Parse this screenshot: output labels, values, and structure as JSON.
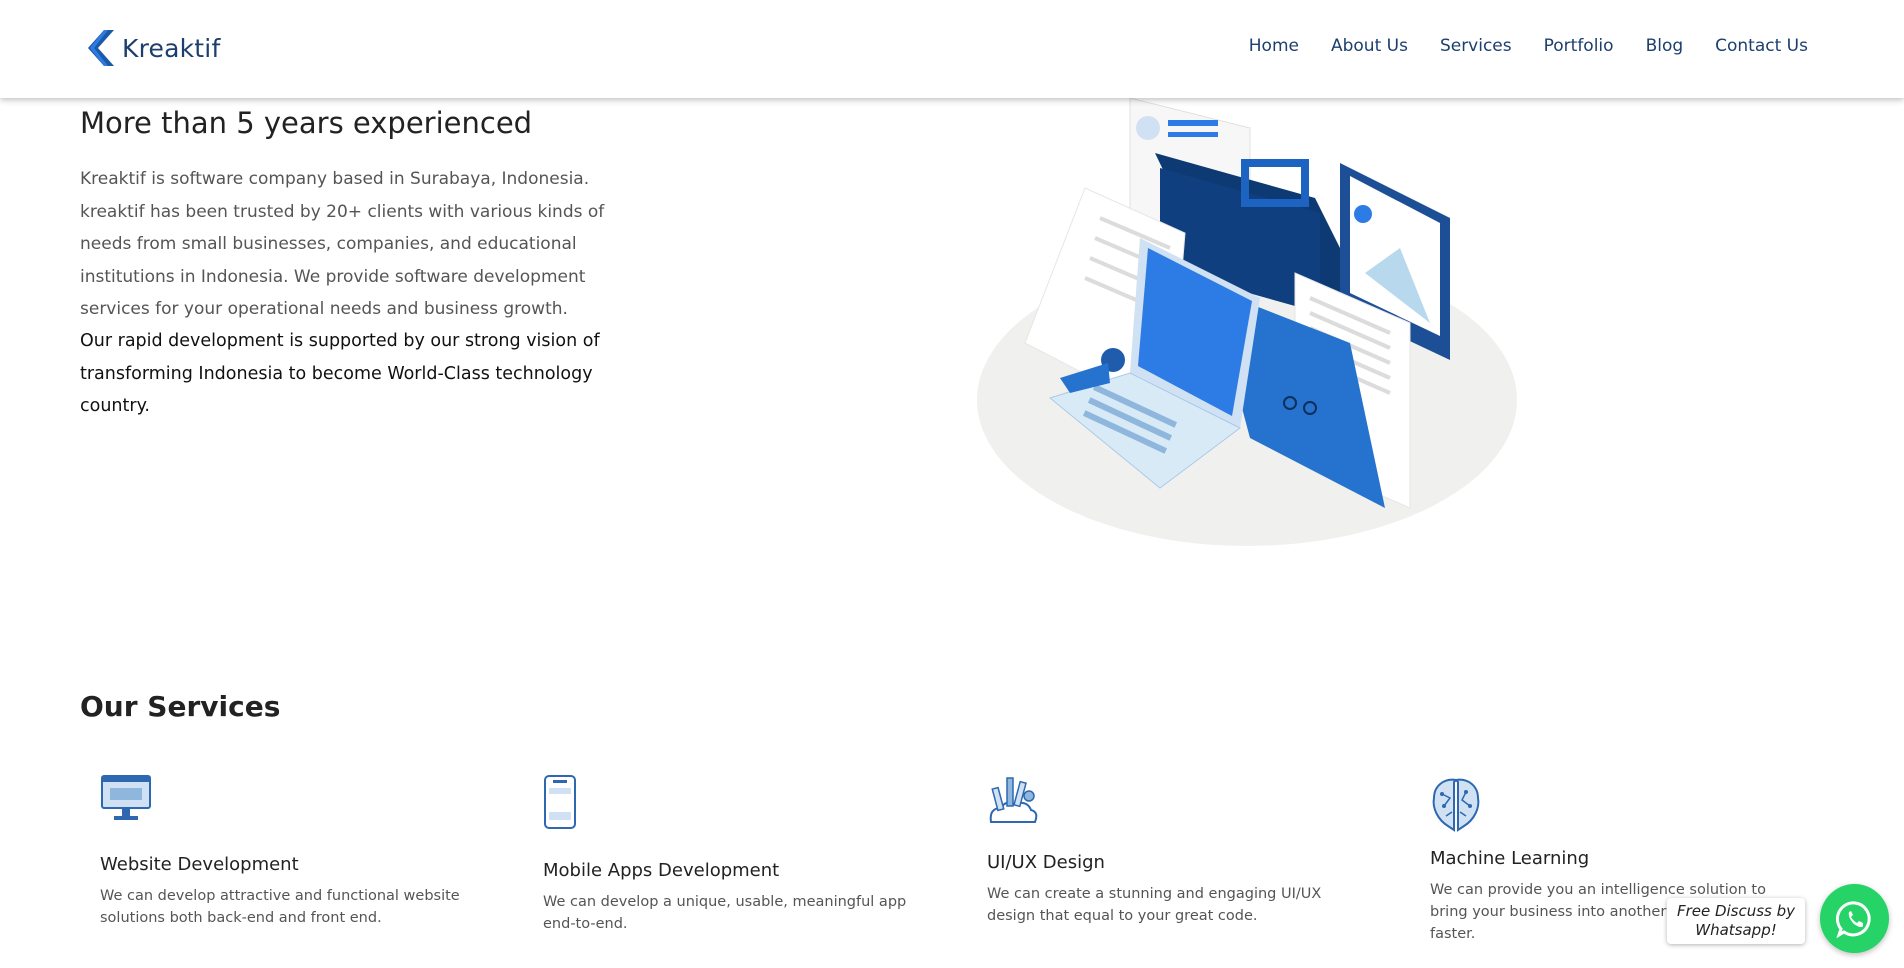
{
  "brand": {
    "name": "Kreaktif",
    "logo_icon": "chevron-left-logo",
    "color": "#1c3f6e",
    "accent": "#2d7be5"
  },
  "nav": {
    "items": [
      {
        "label": "Home"
      },
      {
        "label": "About Us"
      },
      {
        "label": "Services"
      },
      {
        "label": "Portfolio"
      },
      {
        "label": "Blog"
      },
      {
        "label": "Contact Us"
      }
    ]
  },
  "about": {
    "title": "More than 5 years experienced",
    "description": "Kreaktif is software company based in Surabaya, Indonesia. kreaktif has been trusted by 20+ clients with various kinds of needs from small businesses, companies, and educational institutions in Indonesia. We provide software development services for your operational needs and business growth.",
    "vision": "Our rapid development is supported by our strong vision of transforming Indonesia to become World-Class technology country."
  },
  "services": {
    "title": "Our Services",
    "items": [
      {
        "icon": "monitor-icon",
        "title": "Website Development",
        "description": "We can develop attractive and functional website solutions both back-end and front end."
      },
      {
        "icon": "smartphone-icon",
        "title": "Mobile Apps Development",
        "description": "We can develop a unique, usable, meaningful app end-to-end."
      },
      {
        "icon": "design-tools-icon",
        "title": "UI/UX Design",
        "description": "We can create a stunning and engaging UI/UX design that equal to your great code."
      },
      {
        "icon": "brain-icon",
        "title": "Machine Learning",
        "description": "We can provide you an intelligence solution to bring your business into another level, leaner, and faster."
      }
    ]
  },
  "whatsapp": {
    "label": "Free Discuss by Whatsapp!",
    "icon": "whatsapp-icon",
    "color": "#25d366"
  }
}
